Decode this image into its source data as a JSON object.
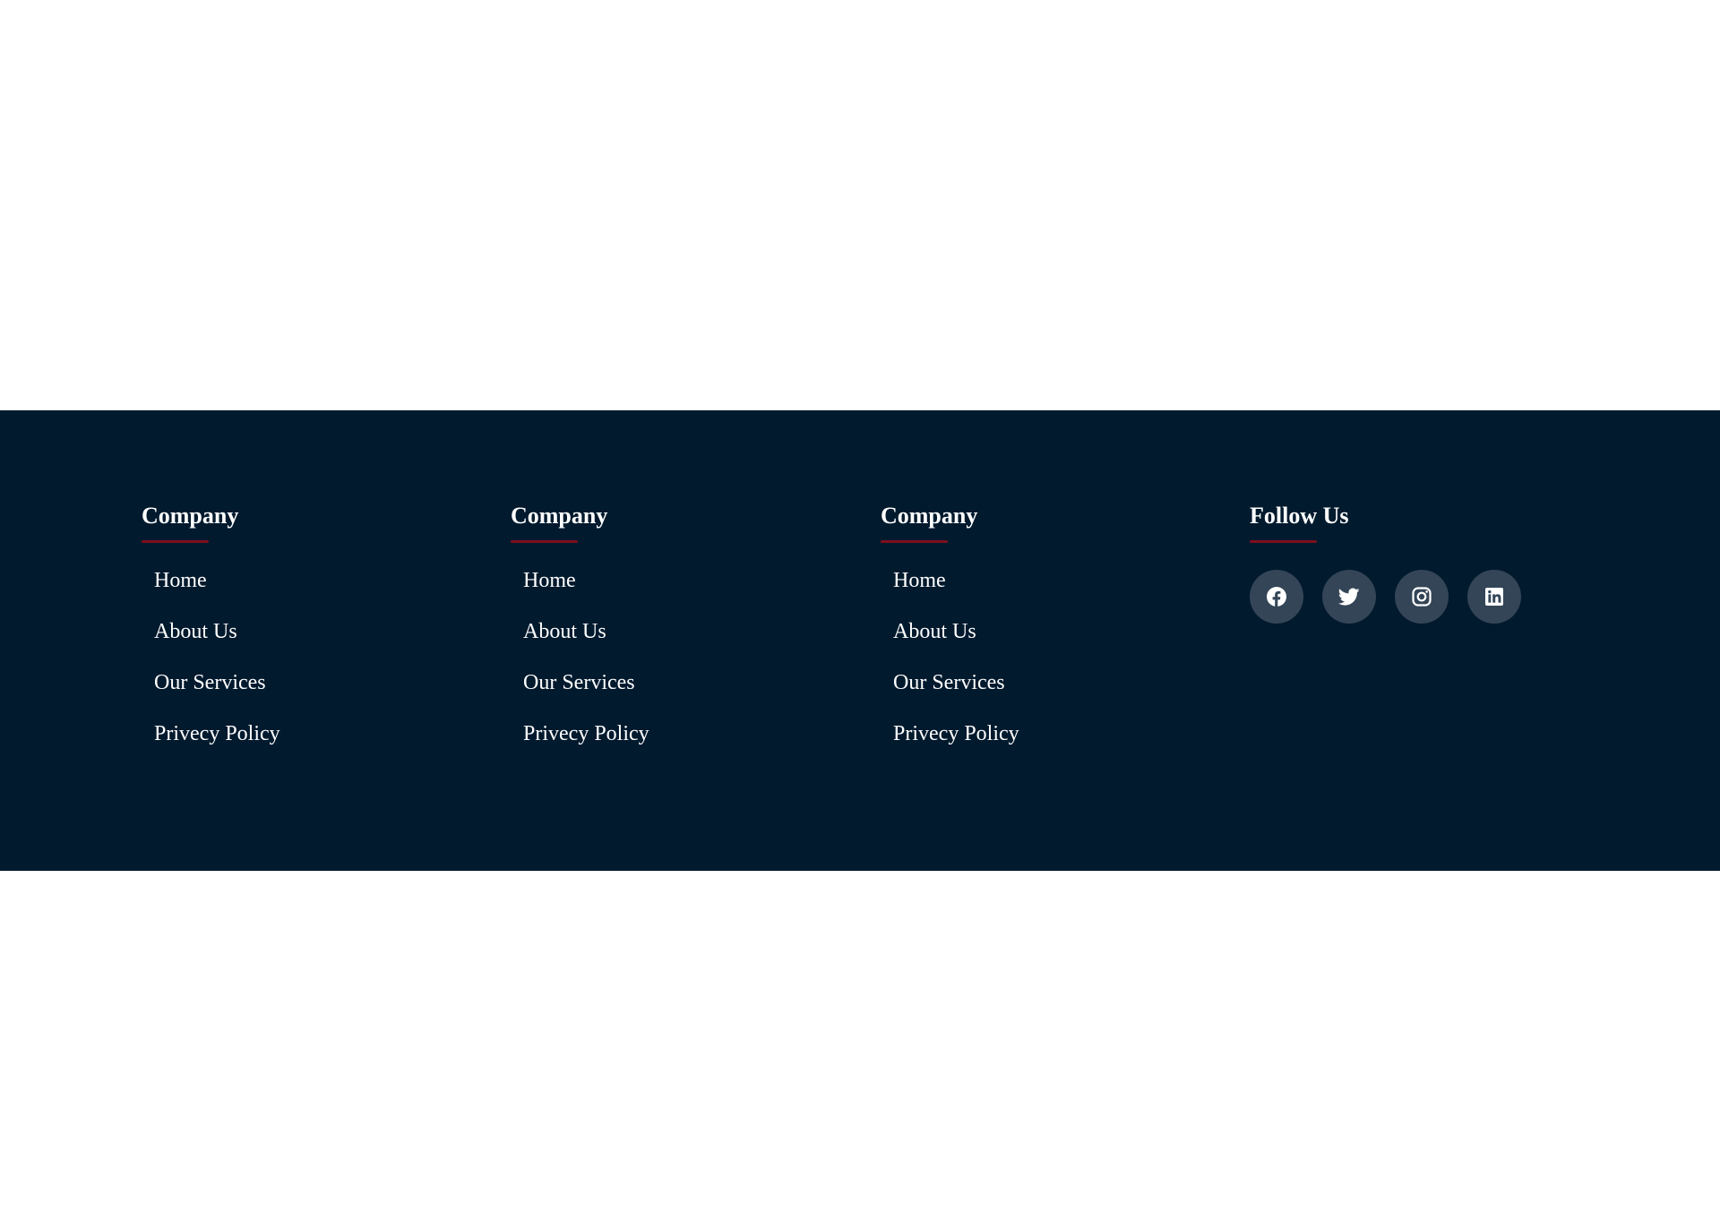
{
  "colors": {
    "footer_bg": "#021a2e",
    "accent": "#7d0f1f",
    "social_bg": "#334557",
    "text": "#ffffff"
  },
  "columns": [
    {
      "title": "Company",
      "links": [
        "Home",
        "About Us",
        "Our Services",
        "Privecy Policy"
      ]
    },
    {
      "title": "Company",
      "links": [
        "Home",
        "About Us",
        "Our Services",
        "Privecy Policy"
      ]
    },
    {
      "title": "Company",
      "links": [
        "Home",
        "About Us",
        "Our Services",
        "Privecy Policy"
      ]
    }
  ],
  "follow": {
    "title": "Follow Us",
    "icons": [
      "facebook-icon",
      "twitter-icon",
      "instagram-icon",
      "linkedin-icon"
    ]
  }
}
